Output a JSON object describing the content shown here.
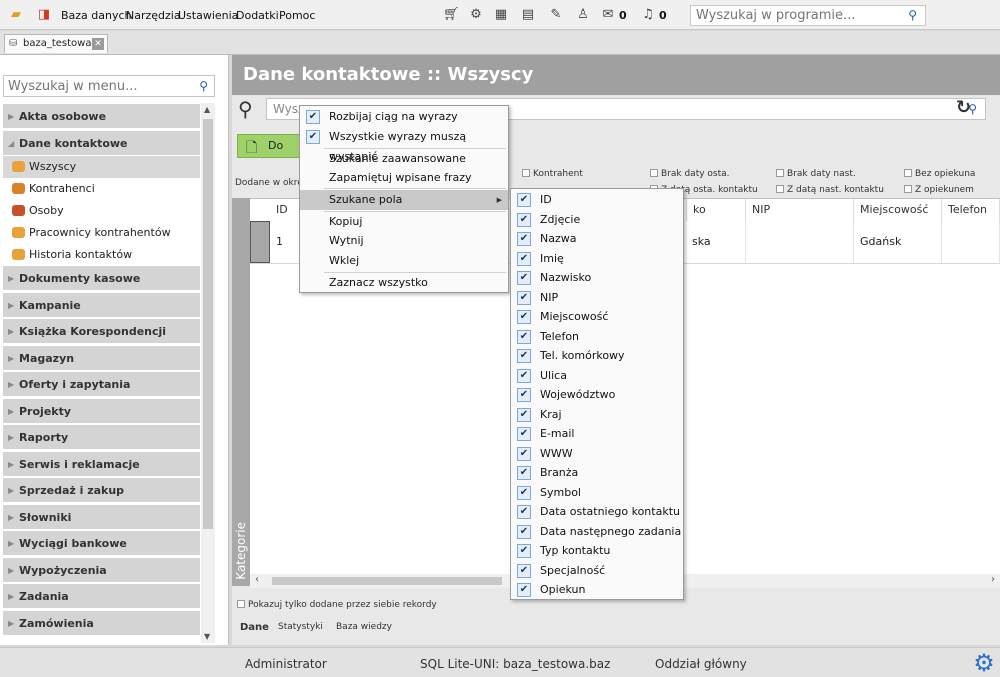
{
  "menu": [
    "Baza danych",
    "Narzędzia",
    "Ustawienia",
    "Dodatki",
    "Pomoc"
  ],
  "toolbar": {
    "mail_count": "0",
    "bell_count": "0",
    "search_placeholder": "Wyszukaj w programie..."
  },
  "tab": {
    "label": "baza_testowa"
  },
  "sidebar": {
    "search_placeholder": "Wyszukaj w menu...",
    "sections": {
      "akta": "Akta osobowe",
      "kontakty": "Dane kontaktowe",
      "rest": [
        "Dokumenty kasowe",
        "Kampanie",
        "Książka Korespondencji",
        "Magazyn",
        "Oferty i zapytania",
        "Projekty",
        "Raporty",
        "Serwis i reklamacje",
        "Sprzedaż i zakup",
        "Słowniki",
        "Wyciągi bankowe",
        "Wypożyczenia",
        "Zadania",
        "Zamówienia"
      ]
    },
    "kontakty_items": [
      "Wszyscy",
      "Kontrahenci",
      "Osoby",
      "Pracownicy kontrahentów",
      "Historia kontaktów"
    ]
  },
  "main": {
    "title": "Dane kontaktowe :: Wszyscy",
    "search_placeholder": "Wysz",
    "add_label": "Do",
    "added_in_label": "Dodane w okre",
    "filters": [
      "Kontrahent",
      "Brak daty osta.",
      "Brak daty nast.",
      "Bez opiekuna",
      "Z datą osta. kontaktu",
      "Z datą nast. kontaktu",
      "Z opiekunem"
    ],
    "columns": [
      "ID",
      "ko",
      "NIP",
      "Miejscowość",
      "Telefon"
    ],
    "row": {
      "id": "1",
      "nazwisko": "ska",
      "nip": "",
      "miejscowosc": "Gdańsk",
      "telefon": ""
    },
    "categories_label": "Kategorie",
    "show_own_label": "Pokazuj tylko dodane przez siebie rekordy",
    "bottom_tabs": [
      "Dane",
      "Statystyki",
      "Baza wiedzy"
    ]
  },
  "context_menu": {
    "split": "Rozbijaj ciąg na wyrazy",
    "all_words": "Wszystkie wyrazy muszą wystąpić",
    "advanced": "Szukanie zaawansowane",
    "remember": "Zapamiętuj wpisane frazy",
    "fields": "Szukane pola",
    "copy": "Kopiuj",
    "cut": "Wytnij",
    "paste": "Wklej",
    "select_all": "Zaznacz wszystko"
  },
  "fields_submenu": [
    "ID",
    "Zdjęcie",
    "Nazwa",
    "Imię",
    "Nazwisko",
    "NIP",
    "Miejscowość",
    "Telefon",
    "Tel. komórkowy",
    "Ulica",
    "Województwo",
    "Kraj",
    "E-mail",
    "WWW",
    "Branża",
    "Symbol",
    "Data ostatniego kontaktu",
    "Data następnego zadania",
    "Typ kontaktu",
    "Specjalność",
    "Opiekun"
  ],
  "status": {
    "user": "Administrator",
    "db": "SQL Lite-UNI: baza_testowa.baz",
    "branch": "Oddział główny"
  },
  "colors": {
    "accent_green": "#9ed16a",
    "title_bar": "#a0a0a0",
    "gear": "#2a72c8"
  }
}
